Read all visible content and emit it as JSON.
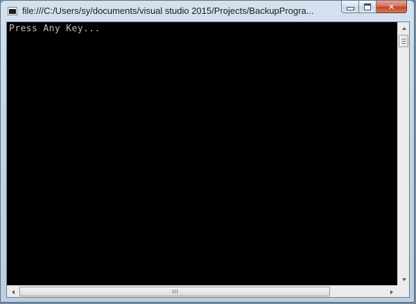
{
  "window": {
    "title": "file:///C:/Users/sy/documents/visual studio 2015/Projects/BackupProgra...",
    "icon": "console-app-icon",
    "controls": {
      "minimize_icon": "minimize-icon",
      "maximize_icon": "maximize-icon",
      "close_icon": "close-icon",
      "close_glyph": "✕"
    }
  },
  "console": {
    "output": "Press Any Key...",
    "background": "#000000",
    "foreground": "#c0c0c0"
  },
  "scrollbars": {
    "vertical": {
      "position": "top"
    },
    "horizontal": {
      "position": "left"
    }
  },
  "colors": {
    "close_button": "#c1452b",
    "titlebar": "#c3d5e6"
  }
}
